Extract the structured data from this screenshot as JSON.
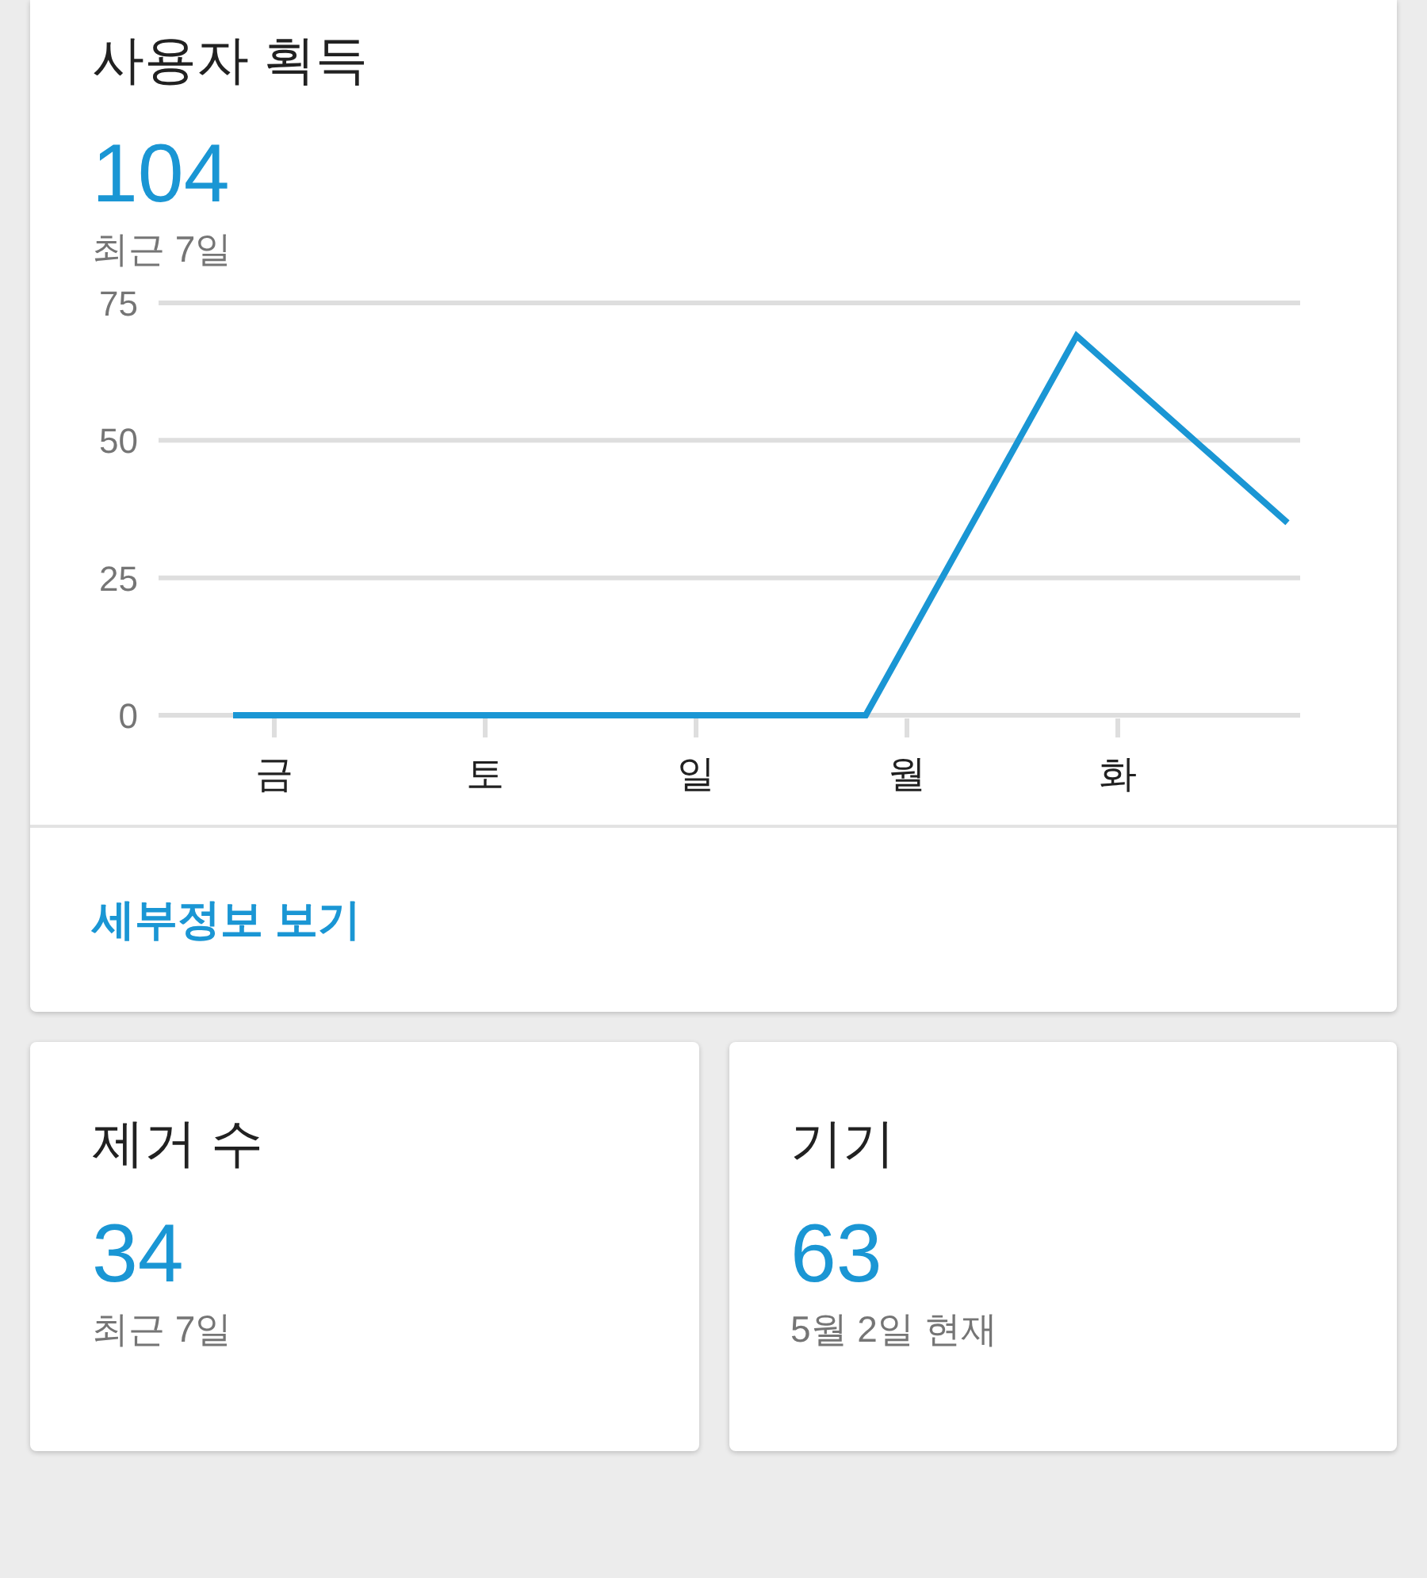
{
  "acquisition": {
    "title": "사용자 획득",
    "value": "104",
    "period": "최근 7일",
    "chart_data": {
      "type": "line",
      "categories": [
        "금",
        "토",
        "일",
        "월",
        "화",
        null
      ],
      "series": [
        {
          "color": "#1a96d4",
          "values": [
            0,
            0,
            0,
            0,
            69,
            35
          ]
        }
      ],
      "ylim": [
        0,
        75
      ],
      "yticks": [
        0,
        25,
        50,
        75
      ]
    },
    "link": "세부정보 보기"
  },
  "cards": [
    {
      "title": "제거 수",
      "value": "34",
      "caption": "최근 7일"
    },
    {
      "title": "기기",
      "value": "63",
      "caption": "5월 2일 현재"
    }
  ]
}
